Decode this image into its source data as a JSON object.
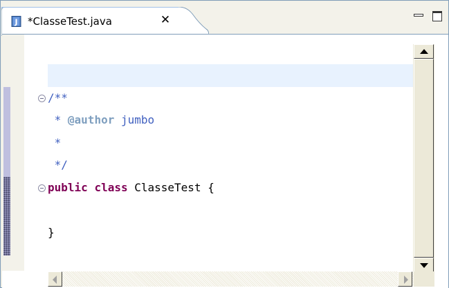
{
  "editor_tab": {
    "title": "*ClasseTest.java",
    "close_glyph": "✕",
    "icon": "java-file-icon",
    "active": true
  },
  "window_controls": {
    "minimize_icon": "minimize-icon",
    "maximize_icon": "maximize-icon"
  },
  "code": {
    "lines": [
      {
        "parts": [
          {
            "text": "",
            "style": "plain"
          }
        ]
      },
      {
        "parts": [
          {
            "text": "",
            "style": "plain"
          }
        ],
        "current": true
      },
      {
        "parts": [
          {
            "text": "/**",
            "style": "comment"
          }
        ],
        "fold": true
      },
      {
        "parts": [
          {
            "text": " * ",
            "style": "comment"
          },
          {
            "text": "@author",
            "style": "tag"
          },
          {
            "text": " jumbo",
            "style": "comment"
          }
        ]
      },
      {
        "parts": [
          {
            "text": " *",
            "style": "comment"
          }
        ]
      },
      {
        "parts": [
          {
            "text": " */",
            "style": "comment"
          }
        ]
      },
      {
        "parts": [
          {
            "text": "public",
            "style": "kw"
          },
          {
            "text": " ",
            "style": "plain"
          },
          {
            "text": "class",
            "style": "kw"
          },
          {
            "text": " ClasseTest {",
            "style": "plain"
          }
        ],
        "fold": true
      },
      {
        "parts": [
          {
            "text": "",
            "style": "plain"
          }
        ]
      },
      {
        "parts": [
          {
            "text": "}",
            "style": "plain"
          }
        ]
      }
    ]
  },
  "colors": {
    "comment": "#3f5fbf",
    "javadoc_tag": "#7f9fbf",
    "keyword": "#7f0055",
    "current_line": "#e8f2fe"
  }
}
